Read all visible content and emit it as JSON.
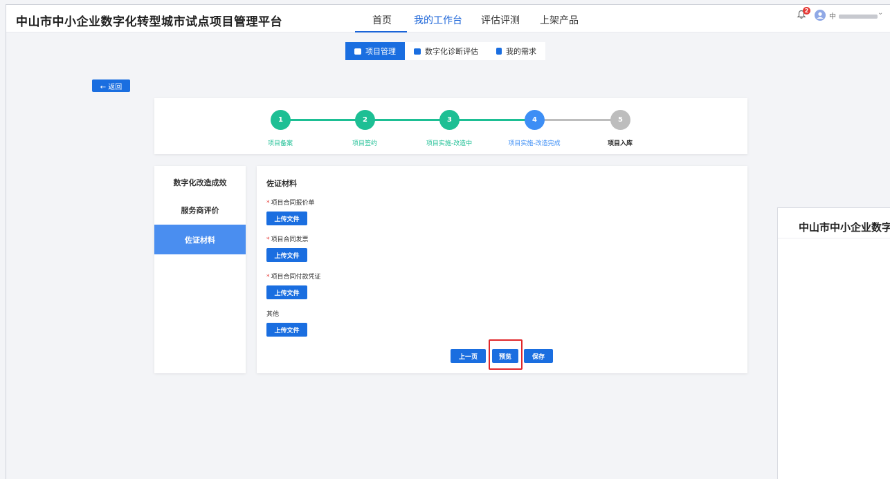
{
  "header": {
    "app_title": "中山市中小企业数字化转型城市试点项目管理平台",
    "nav": [
      "首页",
      "我的工作台",
      "评估评测",
      "上架产品"
    ],
    "notification_count": "2",
    "user_prefix": "中"
  },
  "subtabs": [
    "项目管理",
    "数字化诊断评估",
    "我的需求"
  ],
  "back_label": "← 返回",
  "steps": [
    {
      "num": "1",
      "label": "项目备案",
      "status": "done"
    },
    {
      "num": "2",
      "label": "项目签约",
      "status": "done"
    },
    {
      "num": "3",
      "label": "项目实施-改造中",
      "status": "done"
    },
    {
      "num": "4",
      "label": "项目实施-改造完成",
      "status": "current"
    },
    {
      "num": "5",
      "label": "项目入库",
      "status": "pending"
    }
  ],
  "left_menu": [
    "数字化改造成效",
    "服务商评价",
    "佐证材料"
  ],
  "panel": {
    "title": "佐证材料",
    "fields": [
      {
        "label": "项目合同报价单",
        "required": true
      },
      {
        "label": "项目合同发票",
        "required": true
      },
      {
        "label": "项目合同付款凭证",
        "required": true
      },
      {
        "label": "其他",
        "required": false
      }
    ],
    "upload_label": "上传文件",
    "buttons": {
      "prev": "上一页",
      "preview": "预览",
      "save": "保存"
    }
  },
  "right_panel": {
    "title": "中山市中小企业数字"
  },
  "colors": {
    "primary": "#1a6ee0",
    "step_done": "#1dbf94",
    "step_current": "#3d8ef5",
    "step_pending": "#bdbdbd",
    "highlight": "#e0262a"
  }
}
